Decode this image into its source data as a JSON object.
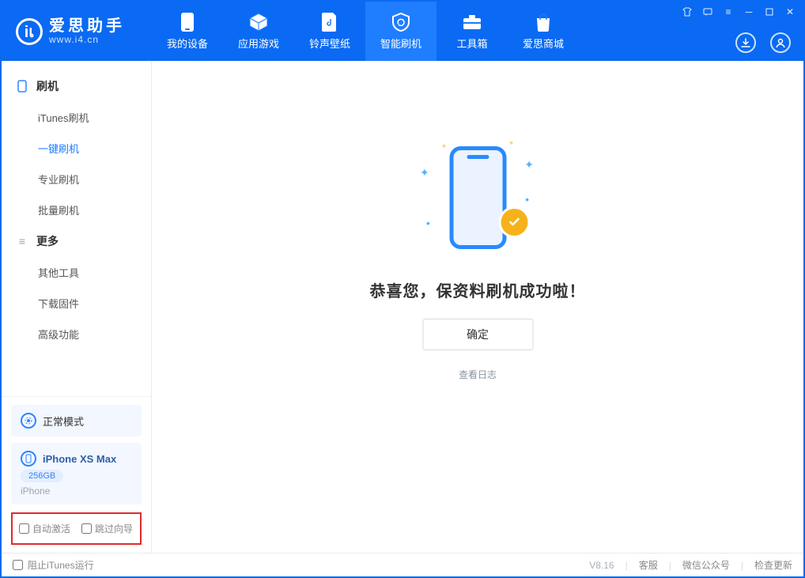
{
  "brand": {
    "cn": "爱思助手",
    "en": "www.i4.cn"
  },
  "tabs": [
    {
      "label": "我的设备"
    },
    {
      "label": "应用游戏"
    },
    {
      "label": "铃声壁纸"
    },
    {
      "label": "智能刷机"
    },
    {
      "label": "工具箱"
    },
    {
      "label": "爱思商城"
    }
  ],
  "sidebar": {
    "group1": {
      "title": "刷机",
      "items": [
        "iTunes刷机",
        "一键刷机",
        "专业刷机",
        "批量刷机"
      ],
      "activeIndex": 1
    },
    "group2": {
      "title": "更多",
      "items": [
        "其他工具",
        "下载固件",
        "高级功能"
      ]
    }
  },
  "mode_card": {
    "label": "正常模式"
  },
  "device_card": {
    "name": "iPhone XS Max",
    "storage": "256GB",
    "type": "iPhone"
  },
  "options": {
    "auto_activate": "自动激活",
    "skip_guide": "跳过向导"
  },
  "main": {
    "success": "恭喜您，保资料刷机成功啦！",
    "ok": "确定",
    "view_log": "查看日志"
  },
  "statusbar": {
    "block_itunes": "阻止iTunes运行",
    "version": "V8.16",
    "links": [
      "客服",
      "微信公众号",
      "检查更新"
    ]
  }
}
